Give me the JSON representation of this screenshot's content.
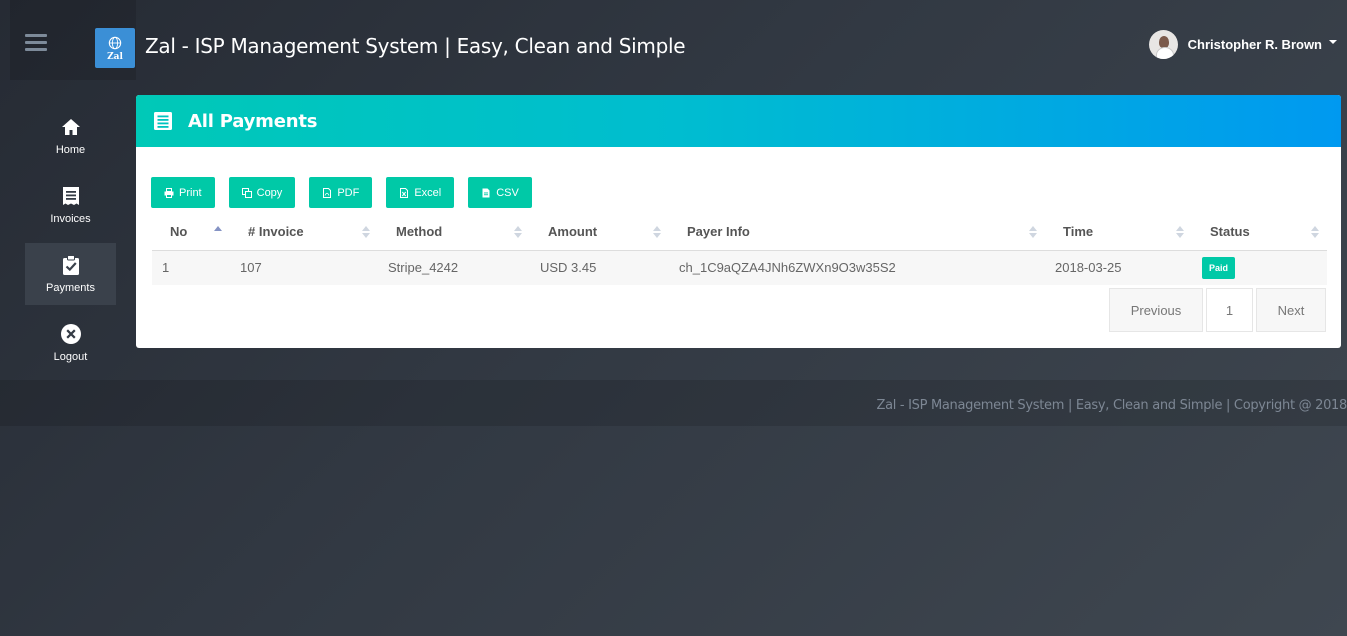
{
  "app": {
    "logo_text": "Zal",
    "title": "Zal - ISP Management System | Easy, Clean and Simple"
  },
  "user": {
    "name": "Christopher R. Brown"
  },
  "sidebar": {
    "items": [
      {
        "label": "Home",
        "icon": "home-icon",
        "active": false
      },
      {
        "label": "Invoices",
        "icon": "invoice-icon",
        "active": false
      },
      {
        "label": "Payments",
        "icon": "clipboard-check-icon",
        "active": true
      },
      {
        "label": "Logout",
        "icon": "close-circle-icon",
        "active": false
      }
    ]
  },
  "page": {
    "title": "All Payments",
    "toolbar": [
      {
        "label": "Print",
        "icon": "print-icon"
      },
      {
        "label": "Copy",
        "icon": "copy-icon"
      },
      {
        "label": "PDF",
        "icon": "file-pdf-icon"
      },
      {
        "label": "Excel",
        "icon": "file-excel-icon"
      },
      {
        "label": "CSV",
        "icon": "file-csv-icon"
      }
    ],
    "table": {
      "columns": [
        "No",
        "# Invoice",
        "Method",
        "Amount",
        "Payer Info",
        "Time",
        "Status"
      ],
      "rows": [
        {
          "no": "1",
          "invoice": "107",
          "method": "Stripe_4242",
          "amount": "USD 3.45",
          "payer_info": "ch_1C9aQZA4JNh6ZWXn9O3w35S2",
          "time": "2018-03-25",
          "status": "Paid"
        }
      ]
    },
    "pagination": {
      "previous": "Previous",
      "current": "1",
      "next": "Next"
    }
  },
  "footer": {
    "text": "Zal - ISP Management System | Easy, Clean and Simple | Copyright @ 2018"
  },
  "colors": {
    "accent": "#00c9a7",
    "header_start": "#00c9b7",
    "header_end": "#0099f0",
    "logo_bg": "#3b8fd6"
  }
}
